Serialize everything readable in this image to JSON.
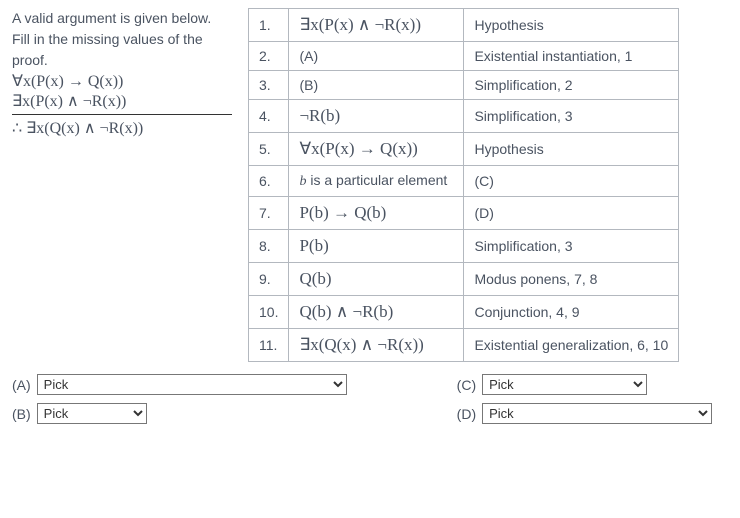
{
  "prompt": {
    "line1": "A valid argument is given below.",
    "line2": "Fill in the missing values of the proof.",
    "premise1": "∀x(P(x) → Q(x))",
    "premise2": "∃x(P(x) ∧ ¬R(x))",
    "conclusion": "∴ ∃x(Q(x) ∧ ¬R(x))"
  },
  "proof": [
    {
      "n": "1.",
      "stmt": "∃x(P(x) ∧ ¬R(x))",
      "just": "Hypothesis"
    },
    {
      "n": "2.",
      "stmt": "(A)",
      "just": "Existential instantiation, 1"
    },
    {
      "n": "3.",
      "stmt": "(B)",
      "just": "Simplification, 2"
    },
    {
      "n": "4.",
      "stmt": "¬R(b)",
      "just": "Simplification, 3"
    },
    {
      "n": "5.",
      "stmt": "∀x(P(x) → Q(x))",
      "just": "Hypothesis"
    },
    {
      "n": "6.",
      "stmt": "b is a particular element",
      "just": "(C)"
    },
    {
      "n": "7.",
      "stmt": "P(b) → Q(b)",
      "just": "(D)"
    },
    {
      "n": "8.",
      "stmt": "P(b)",
      "just": "Simplification, 3"
    },
    {
      "n": "9.",
      "stmt": "Q(b)",
      "just": "Modus ponens, 7, 8"
    },
    {
      "n": "10.",
      "stmt": "Q(b) ∧ ¬R(b)",
      "just": "Conjunction, 4, 9"
    },
    {
      "n": "11.",
      "stmt": "∃x(Q(x) ∧ ¬R(x))",
      "just": "Existential generalization, 6, 10"
    }
  ],
  "answers": {
    "A": {
      "label": "(A)",
      "value": "Pick"
    },
    "B": {
      "label": "(B)",
      "value": "Pick"
    },
    "C": {
      "label": "(C)",
      "value": "Pick"
    },
    "D": {
      "label": "(D)",
      "value": "Pick"
    }
  }
}
